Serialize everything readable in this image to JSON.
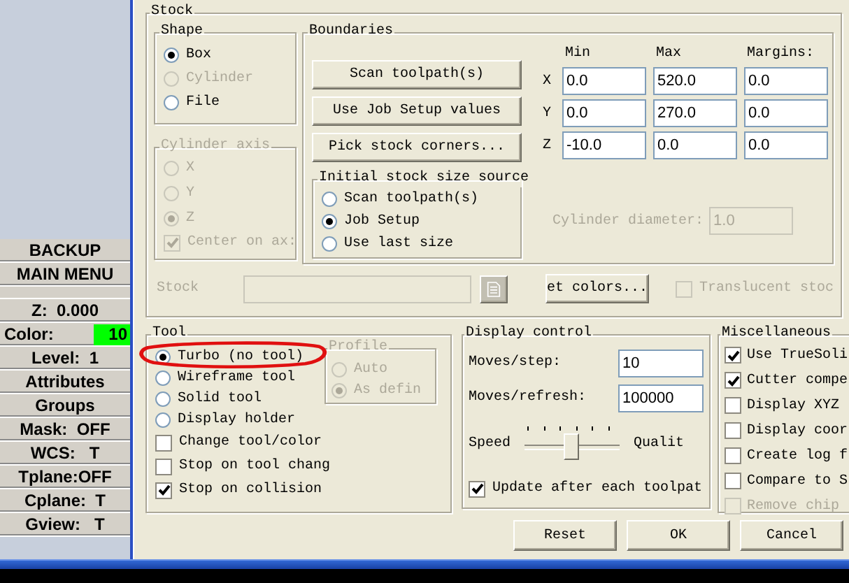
{
  "sidebar": {
    "menu_buttons": [
      {
        "label": "BACKUP"
      },
      {
        "label": "MAIN MENU"
      }
    ],
    "status_items": [
      {
        "kind": "text",
        "label": "Z:  0.000"
      },
      {
        "kind": "color",
        "label": "Color:",
        "value": "10",
        "color": "#00ff00"
      },
      {
        "kind": "text",
        "label": "Level:  1"
      },
      {
        "kind": "text",
        "label": "Attributes"
      },
      {
        "kind": "text",
        "label": "Groups"
      },
      {
        "kind": "text",
        "label": "Mask:  OFF"
      },
      {
        "kind": "text",
        "label": "WCS:   T"
      },
      {
        "kind": "text",
        "label": "Tplane:OFF"
      },
      {
        "kind": "text",
        "label": "Cplane:  T"
      },
      {
        "kind": "text",
        "label": "Gview:   T"
      }
    ]
  },
  "stock": {
    "title": "Stock",
    "shape": {
      "title": "Shape",
      "options": [
        {
          "label": "Box",
          "selected": true,
          "disabled": false
        },
        {
          "label": "Cylinder",
          "selected": false,
          "disabled": true
        },
        {
          "label": "File",
          "selected": false,
          "disabled": false
        }
      ]
    },
    "cylinder_axis": {
      "title": "Cylinder axis",
      "disabled": true,
      "options": [
        {
          "label": "X",
          "selected": false
        },
        {
          "label": "Y",
          "selected": false
        },
        {
          "label": "Z",
          "selected": true
        }
      ],
      "center": {
        "label": "Center on ax:",
        "checked": true
      }
    },
    "boundaries": {
      "title": "Boundaries",
      "buttons": [
        "Scan toolpath(s)",
        "Use Job Setup values",
        "Pick stock corners..."
      ],
      "columns": [
        "Min",
        "Max",
        "Margins:"
      ],
      "rows": [
        {
          "axis": "X",
          "values": [
            "0.0",
            "520.0",
            "0.0"
          ]
        },
        {
          "axis": "Y",
          "values": [
            "0.0",
            "270.0",
            "0.0"
          ]
        },
        {
          "axis": "Z",
          "values": [
            "-10.0",
            "0.0",
            "0.0"
          ]
        }
      ],
      "initial_source": {
        "title": "Initial stock size source",
        "options": [
          {
            "label": "Scan toolpath(s)",
            "selected": false
          },
          {
            "label": "Job Setup",
            "selected": true
          },
          {
            "label": "Use last size",
            "selected": false
          }
        ]
      },
      "cylinder_diameter": {
        "label": "Cylinder diameter:",
        "value": "1.0",
        "disabled": true
      }
    },
    "stock_file": {
      "label": "Stock",
      "disabled": true
    },
    "colors_button": "et colors...",
    "translucent": {
      "label": "Translucent stoc",
      "checked": false,
      "disabled": true
    }
  },
  "tool": {
    "title": "Tool",
    "modes": [
      {
        "label": "Turbo (no tool)",
        "selected": true
      },
      {
        "label": "Wireframe tool",
        "selected": false
      },
      {
        "label": "Solid tool",
        "selected": false
      },
      {
        "label": "Display holder",
        "selected": false
      }
    ],
    "profile": {
      "title": "Profile",
      "disabled": true,
      "options": [
        {
          "label": "Auto",
          "selected": false
        },
        {
          "label": "As defin",
          "selected": true
        }
      ]
    },
    "options": [
      {
        "label": "Change tool/color",
        "checked": false
      },
      {
        "label": "Stop on tool chang",
        "checked": false
      },
      {
        "label": "Stop on collision",
        "checked": true
      }
    ]
  },
  "display_control": {
    "title": "Display control",
    "fields": [
      {
        "label": "Moves/step:",
        "value": "10"
      },
      {
        "label": "Moves/refresh:",
        "value": "100000"
      }
    ],
    "slider": {
      "left_label": "Speed",
      "right_label": "Qualit",
      "level": 0.5
    },
    "update": {
      "label": "Update after each toolpat",
      "checked": true
    }
  },
  "miscellaneous": {
    "title": "Miscellaneous",
    "options": [
      {
        "label": "Use TrueSoli",
        "checked": true,
        "disabled": false
      },
      {
        "label": "Cutter compe",
        "checked": true,
        "disabled": false
      },
      {
        "label": "Display XYZ",
        "checked": false,
        "disabled": false
      },
      {
        "label": "Display coor",
        "checked": false,
        "disabled": false
      },
      {
        "label": "Create log f",
        "checked": false,
        "disabled": false
      },
      {
        "label": "Compare to S",
        "checked": false,
        "disabled": false
      },
      {
        "label": "Remove chip",
        "checked": false,
        "disabled": true
      }
    ]
  },
  "buttons": [
    "Reset",
    "OK",
    "Cancel"
  ]
}
